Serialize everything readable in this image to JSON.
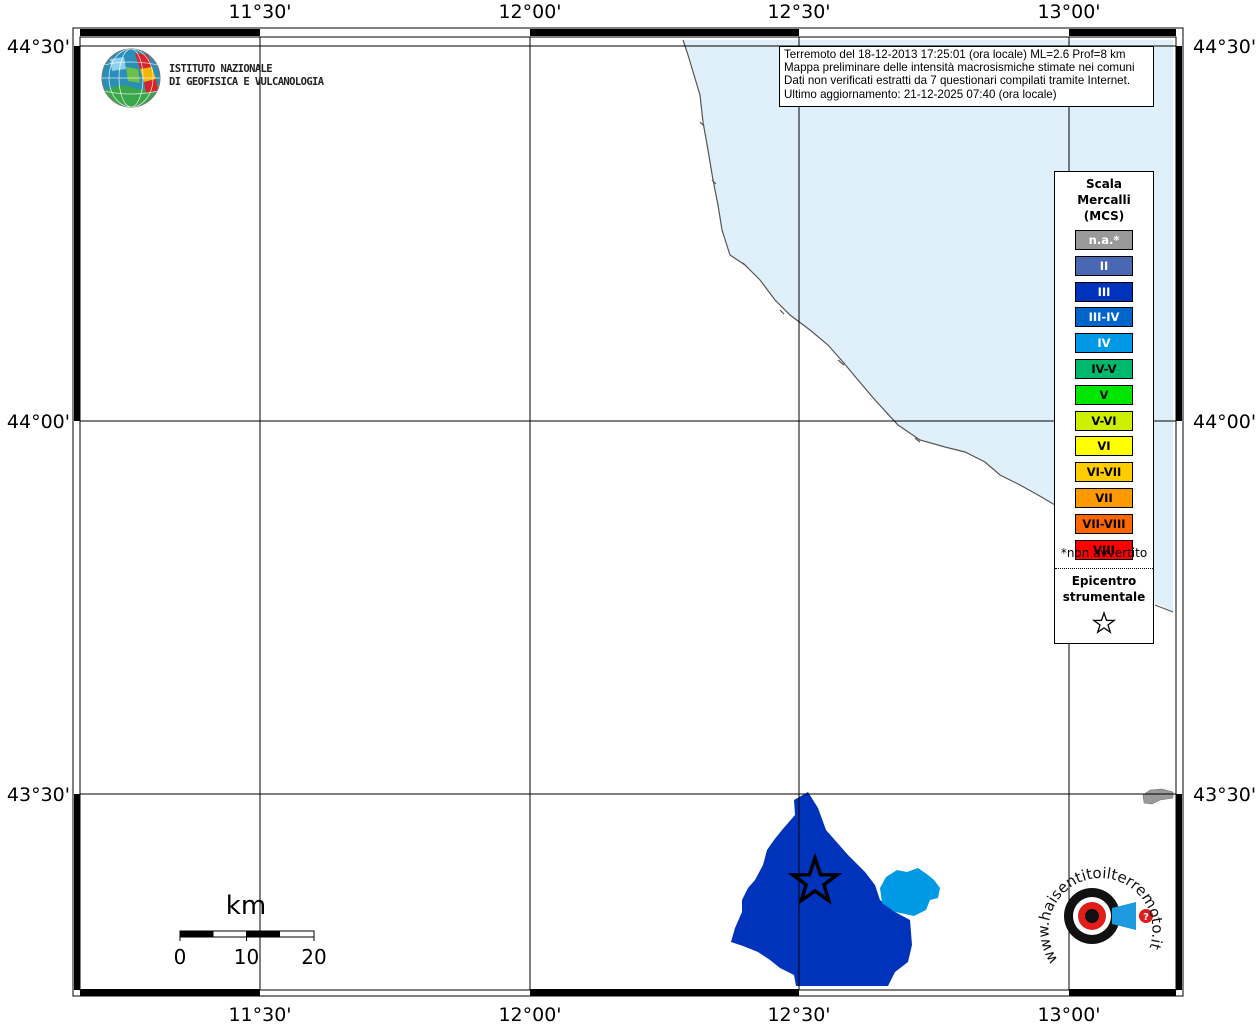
{
  "map": {
    "longitude_labels": [
      "11°30'",
      "12°00'",
      "12°30'",
      "13°00'"
    ],
    "latitude_labels": [
      "44°30'",
      "44°00'",
      "43°30'"
    ],
    "sea_color": "#dff0fb",
    "coast_color": "#555555",
    "grid_color": "#000000"
  },
  "info_box": {
    "line1": "Terremoto del 18-12-2013 17:25:01 (ora locale) ML=2.6 Prof=8 km",
    "line2": "Mappa preliminare delle intensità macrosismiche stimate nei comuni",
    "line3": "Dati non verificati estratti da 7 questionari compilati tramite Internet.",
    "line4": "Ultimo aggiornamento: 21-12-2025 07:40 (ora locale)"
  },
  "legend": {
    "title_line1": "Scala",
    "title_line2": "Mercalli",
    "title_line3": "(MCS)",
    "items": [
      {
        "label": "n.a.*",
        "color": "#999999",
        "text_color": "#ffffff"
      },
      {
        "label": "II",
        "color": "#4a67b3",
        "text_color": "#ffffff"
      },
      {
        "label": "III",
        "color": "#0033bb",
        "text_color": "#ffffff"
      },
      {
        "label": "III-IV",
        "color": "#0066cc",
        "text_color": "#ffffff"
      },
      {
        "label": "IV",
        "color": "#0099e6",
        "text_color": "#ffffff"
      },
      {
        "label": "IV-V",
        "color": "#00b86b",
        "text_color": "#000000"
      },
      {
        "label": "V",
        "color": "#00e600",
        "text_color": "#000000"
      },
      {
        "label": "V-VI",
        "color": "#ccf000",
        "text_color": "#000000"
      },
      {
        "label": "VI",
        "color": "#ffff00",
        "text_color": "#000000"
      },
      {
        "label": "VI-VII",
        "color": "#ffcc00",
        "text_color": "#000000"
      },
      {
        "label": "VII",
        "color": "#ff9900",
        "text_color": "#000000"
      },
      {
        "label": "VII-VIII",
        "color": "#ff6600",
        "text_color": "#000000"
      },
      {
        "label": "VIII",
        "color": "#ff0000",
        "text_color": "#000000"
      }
    ],
    "note": "*non avvertito",
    "epicentre_line1": "Epicentro",
    "epicentre_line2": "strumentale"
  },
  "regions": [
    {
      "name": "III",
      "color": "#0033bb"
    },
    {
      "name": "IV",
      "color": "#0099e6"
    }
  ],
  "ingv": {
    "line1": "ISTITUTO NAZIONALE",
    "line2": "DI GEOFISICA E VULCANOLOGIA"
  },
  "scalebar": {
    "unit": "km",
    "labels": [
      "0",
      "10",
      "20"
    ]
  },
  "hst_logo": {
    "text": "www.haisentitoilterremoto.it"
  }
}
